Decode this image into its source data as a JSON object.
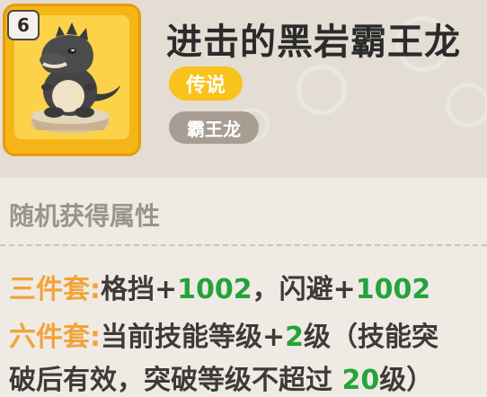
{
  "item": {
    "level": "6",
    "name": "进击的黑岩霸王龙",
    "rarity": "传说",
    "type": "霸王龙"
  },
  "section": {
    "heading": "随机获得属性"
  },
  "bonus_3": {
    "label": "三件套:",
    "attr1": "格挡",
    "plus1": "+",
    "val1": "1002",
    "sep": "，",
    "attr2": "闪避",
    "plus2": "+",
    "val2": "1002"
  },
  "bonus_6": {
    "label": "六件套:",
    "text1": "当前技能等级",
    "plus": "+",
    "val1": "2",
    "text2": "级（技能突",
    "text3": "破后有效，突破等级不超过 ",
    "val2": "20",
    "text4": "级）"
  },
  "colors": {
    "frame": "#f6b517",
    "rarity": "#f9c21c",
    "type_tag": "#a79d92",
    "set_label": "#f2a33a",
    "number": "#24a33a"
  },
  "icons": [
    "black-tyrannosaurus-figure-icon"
  ]
}
